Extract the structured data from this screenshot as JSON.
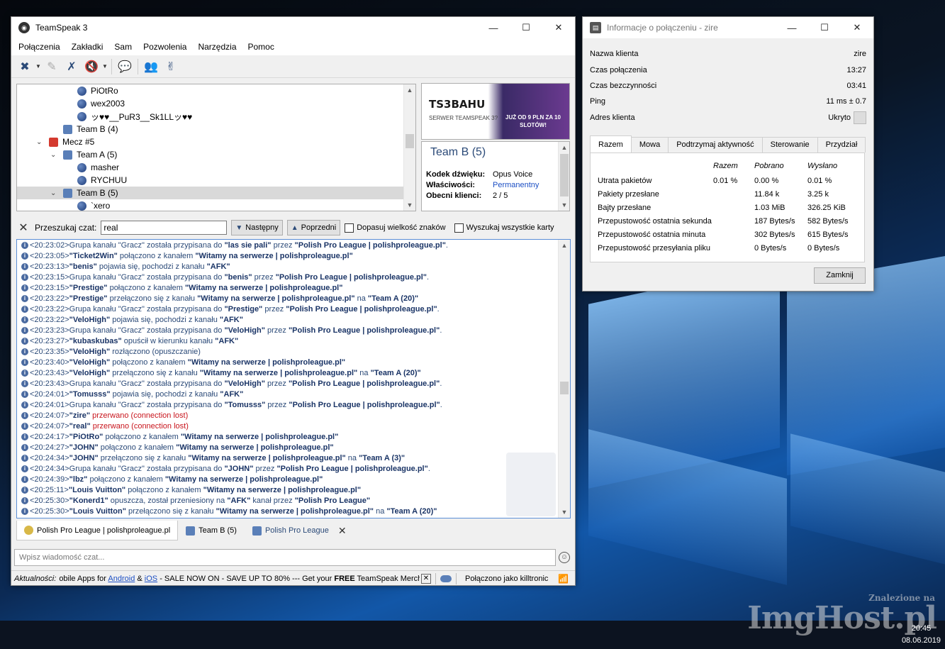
{
  "main": {
    "title": "TeamSpeak 3",
    "menu": [
      "Połączenia",
      "Zakładki",
      "Sam",
      "Pozwolenia",
      "Narzędzia",
      "Pomoc"
    ],
    "tree": [
      {
        "label": "PiOtRo",
        "type": "user",
        "indent": 85
      },
      {
        "label": "wex2003",
        "type": "user",
        "indent": 85
      },
      {
        "label": "ッ♥♥__PuR3__Sk1LLッ♥♥",
        "type": "user",
        "indent": 85
      },
      {
        "label": "Team B (4)",
        "type": "channel",
        "indent": 65
      },
      {
        "label": "Mecz #5",
        "type": "channel-red",
        "indent": 45,
        "expanded": true
      },
      {
        "label": "Team A (5)",
        "type": "channel",
        "indent": 65,
        "expanded": true
      },
      {
        "label": "masher",
        "type": "user",
        "indent": 85
      },
      {
        "label": "RYCHUU",
        "type": "user",
        "indent": 85
      },
      {
        "label": "Team B (5)",
        "type": "channel",
        "indent": 65,
        "expanded": true,
        "selected": true
      },
      {
        "label": "`xero",
        "type": "user",
        "indent": 85
      }
    ],
    "banner": {
      "logo": "TS3BAHU",
      "sub": "SERWER TEAMSPEAK 3?",
      "promo": "JUŻ OD 9 PLN ZA 10 SLOTÓW!"
    },
    "channel_info": {
      "title": "Team B (5)",
      "codec_label": "Kodek dźwięku:",
      "codec": "Opus Voice",
      "props_label": "Właściwości:",
      "props": "Permanentny",
      "clients_label": "Obecni klienci:",
      "clients": "2 / 5"
    },
    "search": {
      "label": "Przeszukaj czat:",
      "value": "real",
      "next": "Następny",
      "prev": "Poprzedni",
      "match_case": "Dopasuj wielkość znaków",
      "all_tabs": "Wyszukaj wszystkie karty"
    },
    "chat": [
      {
        "t": "<20:23:02>",
        "parts": [
          [
            "m",
            "Grupa kanału \"Gracz\" została przypisana do "
          ],
          [
            "n",
            "\"las sie pali\""
          ],
          [
            "m",
            " przez "
          ],
          [
            "n",
            "\"Polish Pro League | polishproleague.pl\""
          ],
          [
            "m",
            "."
          ]
        ]
      },
      {
        "t": "<20:23:05>",
        "parts": [
          [
            "n",
            "\"Ticket2Win\""
          ],
          [
            "m",
            " połączono z kanałem "
          ],
          [
            "n",
            "\"Witamy na serwerze | polishproleague.pl\""
          ]
        ]
      },
      {
        "t": "<20:23:13>",
        "parts": [
          [
            "n",
            "\"benis\""
          ],
          [
            "m",
            " pojawia się, pochodzi z kanału "
          ],
          [
            "n",
            "\"AFK\""
          ]
        ]
      },
      {
        "t": "<20:23:15>",
        "parts": [
          [
            "m",
            "Grupa kanału \"Gracz\" została przypisana do "
          ],
          [
            "n",
            "\"benis\""
          ],
          [
            "m",
            " przez "
          ],
          [
            "n",
            "\"Polish Pro League | polishproleague.pl\""
          ],
          [
            "m",
            "."
          ]
        ]
      },
      {
        "t": "<20:23:15>",
        "parts": [
          [
            "n",
            "\"Prestige\""
          ],
          [
            "m",
            " połączono z kanałem "
          ],
          [
            "n",
            "\"Witamy na serwerze | polishproleague.pl\""
          ]
        ]
      },
      {
        "t": "<20:23:22>",
        "parts": [
          [
            "n",
            "\"Prestige\""
          ],
          [
            "m",
            " przełączono się z kanału "
          ],
          [
            "n",
            "\"Witamy na serwerze | polishproleague.pl\""
          ],
          [
            "m",
            " na "
          ],
          [
            "n",
            "\"Team A (20)\""
          ]
        ]
      },
      {
        "t": "<20:23:22>",
        "parts": [
          [
            "m",
            "Grupa kanału \"Gracz\" została przypisana do "
          ],
          [
            "n",
            "\"Prestige\""
          ],
          [
            "m",
            " przez "
          ],
          [
            "n",
            "\"Polish Pro League | polishproleague.pl\""
          ],
          [
            "m",
            "."
          ]
        ]
      },
      {
        "t": "<20:23:22>",
        "parts": [
          [
            "n",
            "\"VeloHigh\""
          ],
          [
            "m",
            " pojawia się, pochodzi z kanału "
          ],
          [
            "n",
            "\"AFK\""
          ]
        ]
      },
      {
        "t": "<20:23:23>",
        "parts": [
          [
            "m",
            "Grupa kanału \"Gracz\" została przypisana do "
          ],
          [
            "n",
            "\"VeloHigh\""
          ],
          [
            "m",
            " przez "
          ],
          [
            "n",
            "\"Polish Pro League | polishproleague.pl\""
          ],
          [
            "m",
            "."
          ]
        ]
      },
      {
        "t": "<20:23:27>",
        "parts": [
          [
            "n",
            "\"kubaskubas\""
          ],
          [
            "m",
            " opuścił w kierunku kanału "
          ],
          [
            "n",
            "\"AFK\""
          ]
        ]
      },
      {
        "t": "<20:23:35>",
        "parts": [
          [
            "n",
            "\"VeloHigh\""
          ],
          [
            "m",
            " rozłączono (opuszczanie)"
          ]
        ]
      },
      {
        "t": "<20:23:40>",
        "parts": [
          [
            "n",
            "\"VeloHigh\""
          ],
          [
            "m",
            " połączono z kanałem "
          ],
          [
            "n",
            "\"Witamy na serwerze | polishproleague.pl\""
          ]
        ]
      },
      {
        "t": "<20:23:43>",
        "parts": [
          [
            "n",
            "\"VeloHigh\""
          ],
          [
            "m",
            " przełączono się z kanału "
          ],
          [
            "n",
            "\"Witamy na serwerze | polishproleague.pl\""
          ],
          [
            "m",
            " na "
          ],
          [
            "n",
            "\"Team A (20)\""
          ]
        ]
      },
      {
        "t": "<20:23:43>",
        "parts": [
          [
            "m",
            "Grupa kanału \"Gracz\" została przypisana do "
          ],
          [
            "n",
            "\"VeloHigh\""
          ],
          [
            "m",
            " przez "
          ],
          [
            "n",
            "\"Polish Pro League | polishproleague.pl\""
          ],
          [
            "m",
            "."
          ]
        ]
      },
      {
        "t": "<20:24:01>",
        "parts": [
          [
            "n",
            "\"Tomusss\""
          ],
          [
            "m",
            " pojawia się, pochodzi z kanału "
          ],
          [
            "n",
            "\"AFK\""
          ]
        ]
      },
      {
        "t": "<20:24:01>",
        "parts": [
          [
            "m",
            "Grupa kanału \"Gracz\" została przypisana do "
          ],
          [
            "n",
            "\"Tomusss\""
          ],
          [
            "m",
            " przez "
          ],
          [
            "n",
            "\"Polish Pro League | polishproleague.pl\""
          ],
          [
            "m",
            "."
          ]
        ]
      },
      {
        "t": "<20:24:07>",
        "parts": [
          [
            "n",
            "\"zire\""
          ],
          [
            "r",
            " przerwano (connection lost)"
          ]
        ]
      },
      {
        "t": "<20:24:07>",
        "parts": [
          [
            "n",
            "\"real\""
          ],
          [
            "r",
            " przerwano (connection lost)"
          ]
        ]
      },
      {
        "t": "<20:24:17>",
        "parts": [
          [
            "n",
            "\"PiOtRo\""
          ],
          [
            "m",
            " połączono z kanałem "
          ],
          [
            "n",
            "\"Witamy na serwerze | polishproleague.pl\""
          ]
        ]
      },
      {
        "t": "<20:24:27>",
        "parts": [
          [
            "n",
            "\"JOHN\""
          ],
          [
            "m",
            " połączono z kanałem "
          ],
          [
            "n",
            "\"Witamy na serwerze | polishproleague.pl\""
          ]
        ]
      },
      {
        "t": "<20:24:34>",
        "parts": [
          [
            "n",
            "\"JOHN\""
          ],
          [
            "m",
            " przełączono się z kanału "
          ],
          [
            "n",
            "\"Witamy na serwerze | polishproleague.pl\""
          ],
          [
            "m",
            " na "
          ],
          [
            "n",
            "\"Team A (3)\""
          ]
        ]
      },
      {
        "t": "<20:24:34>",
        "parts": [
          [
            "m",
            "Grupa kanału \"Gracz\" została przypisana do "
          ],
          [
            "n",
            "\"JOHN\""
          ],
          [
            "m",
            " przez "
          ],
          [
            "n",
            "\"Polish Pro League | polishproleague.pl\""
          ],
          [
            "m",
            "."
          ]
        ]
      },
      {
        "t": "<20:24:39>",
        "parts": [
          [
            "n",
            "\"lbz\""
          ],
          [
            "m",
            " połączono z kanałem "
          ],
          [
            "n",
            "\"Witamy na serwerze | polishproleague.pl\""
          ]
        ]
      },
      {
        "t": "<20:25:11>",
        "parts": [
          [
            "n",
            "\"Louis Vuitton\""
          ],
          [
            "m",
            " połączono z kanałem "
          ],
          [
            "n",
            "\"Witamy na serwerze | polishproleague.pl\""
          ]
        ]
      },
      {
        "t": "<20:25:30>",
        "parts": [
          [
            "n",
            "\"Konerd1\""
          ],
          [
            "m",
            " opuszcza, został przeniesiony na "
          ],
          [
            "n",
            "\"AFK\""
          ],
          [
            "m",
            " kanał przez "
          ],
          [
            "n",
            "\"Polish Pro League\""
          ]
        ]
      },
      {
        "t": "<20:25:30>",
        "parts": [
          [
            "n",
            "\"Louis Vuitton\""
          ],
          [
            "m",
            " przełączono się z kanału "
          ],
          [
            "n",
            "\"Witamy na serwerze | polishproleague.pl\""
          ],
          [
            "m",
            " na "
          ],
          [
            "n",
            "\"Team A (20)\""
          ]
        ]
      }
    ],
    "tabs": [
      {
        "label": "Polish Pro League | polishproleague.pl",
        "icon": "smiley",
        "active": true
      },
      {
        "label": "Team B (5)",
        "icon": "channel",
        "active": false
      },
      {
        "label": "Polish Pro League",
        "icon": "server",
        "active": false,
        "closable": true
      }
    ],
    "message_placeholder": "Wpisz wiadomość czat...",
    "status": {
      "news_label": "Aktualności:",
      "news_a": "obile Apps for ",
      "news_android": "Android",
      "news_amp": " & ",
      "news_ios": "iOS",
      "news_b": " - SALE NOW ON - SAVE UP TO 80% --- Get your ",
      "news_free": "FREE",
      "news_c": " TeamSpeak Merch B",
      "connected": "Połączono jako killtronic"
    }
  },
  "info": {
    "title": "Informacje o połączeniu - zire",
    "rows": [
      {
        "k": "Nazwa klienta",
        "v": "zire"
      },
      {
        "k": "Czas połączenia",
        "v": "13:27"
      },
      {
        "k": "Czas bezczynności",
        "v": "03:41"
      },
      {
        "k": "Ping",
        "v": "11 ms ± 0.7"
      },
      {
        "k": "Adres klienta",
        "v": "Ukryto"
      }
    ],
    "tabs": [
      "Razem",
      "Mowa",
      "Podtrzymaj aktywność",
      "Sterowanie",
      "Przydział"
    ],
    "headers": [
      "Razem",
      "Pobrano",
      "Wysłano"
    ],
    "stats": [
      {
        "k": "Utrata pakietów",
        "a": "0.01 %",
        "b": "0.00 %",
        "c": "0.01 %"
      },
      {
        "k": "Pakiety przesłane",
        "a": "",
        "b": "11.84 k",
        "c": "3.25 k"
      },
      {
        "k": "Bajty przesłane",
        "a": "",
        "b": "1.03 MiB",
        "c": "326.25 KiB"
      },
      {
        "k": "Przepustowość ostatnia sekunda",
        "a": "",
        "b": "187 Bytes/s",
        "c": "582 Bytes/s"
      },
      {
        "k": "Przepustowość ostatnia minuta",
        "a": "",
        "b": "302 Bytes/s",
        "c": "615 Bytes/s"
      },
      {
        "k": "Przepustowość przesyłania pliku",
        "a": "",
        "b": "0 Bytes/s",
        "c": "0 Bytes/s"
      }
    ],
    "close": "Zamknij"
  },
  "desktop": {
    "time": "20:45",
    "date": "08.06.2019",
    "watermark_small": "Znalezione na",
    "watermark_big": "ImgHost.pl"
  },
  "colors": {
    "accent": "#2b4a78",
    "selection": "#d9d9d9",
    "link": "#1c4fc4",
    "error": "#c8141c"
  }
}
